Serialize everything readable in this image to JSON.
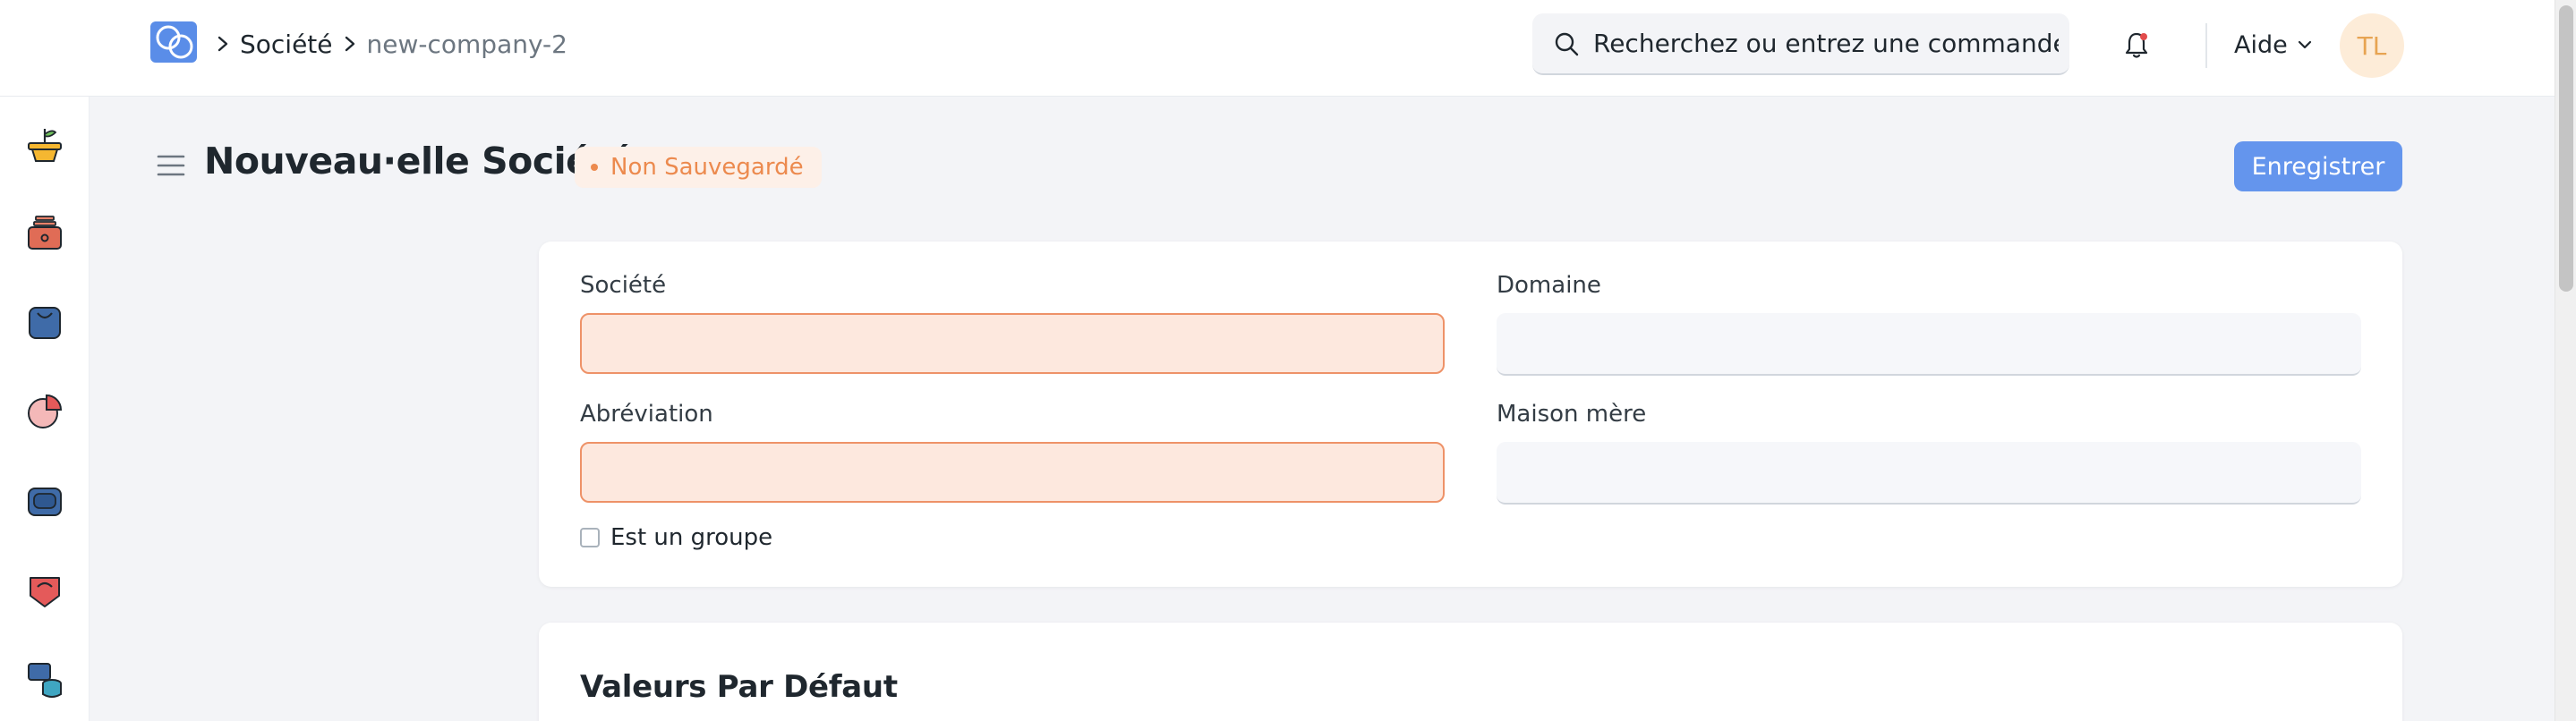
{
  "navbar": {
    "logo": "app-logo",
    "breadcrumb": {
      "parent": "Société",
      "current": "new-company-2"
    },
    "search": {
      "placeholder": "Recherchez ou entrez une commande",
      "icon": "search-icon"
    },
    "notifications_icon": "bell-icon",
    "help_label": "Aide",
    "avatar_initials": "TL"
  },
  "sidebar": {
    "items": [
      {
        "icon": "plant-pot-icon"
      },
      {
        "icon": "cash-register-icon"
      },
      {
        "icon": "shopping-bag-icon"
      },
      {
        "icon": "pie-chart-icon"
      },
      {
        "icon": "drive-icon"
      },
      {
        "icon": "support-icon"
      },
      {
        "icon": "database-icon"
      }
    ]
  },
  "page": {
    "title": "Nouveau·elle Société",
    "status": "Non Sauvegardé",
    "save_label": "Enregistrer"
  },
  "form": {
    "company_label": "Société",
    "company_value": "",
    "domain_label": "Domaine",
    "domain_value": "",
    "abbr_label": "Abréviation",
    "abbr_value": "",
    "parent_label": "Maison mère",
    "parent_value": "",
    "is_group_label": "Est un groupe",
    "is_group_checked": false
  },
  "section2": {
    "title": "Valeurs Par Défaut"
  },
  "colors": {
    "accent": "#6495ed",
    "required_bg": "#fde8de",
    "required_border": "#ee9268",
    "status_text": "#ec8a4e"
  }
}
